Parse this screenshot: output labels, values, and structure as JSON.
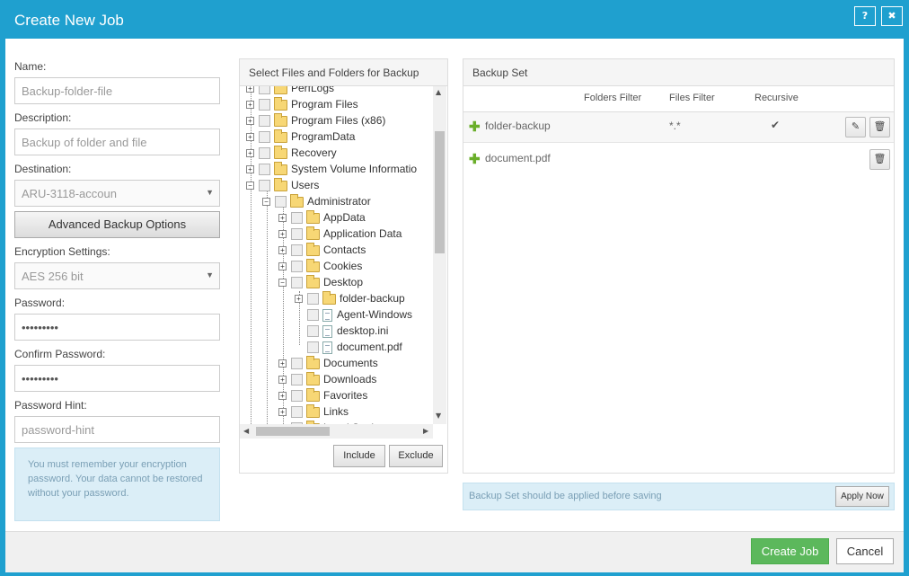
{
  "window": {
    "title": "Create New Job",
    "help_label": "?",
    "close_label": "✖"
  },
  "form": {
    "name_label": "Name:",
    "name_placeholder": "Backup-folder-file",
    "description_label": "Description:",
    "description_placeholder": "Backup of folder and file",
    "destination_label": "Destination:",
    "destination_value": "ARU-3118-accoun",
    "advanced_label": "Advanced Backup Options",
    "encryption_label": "Encryption Settings:",
    "encryption_value": "AES 256 bit",
    "password_label": "Password:",
    "password_value": "•••••••••",
    "confirm_label": "Confirm Password:",
    "confirm_value": "•••••••••",
    "hint_label": "Password Hint:",
    "hint_placeholder": "password-hint",
    "info_text": "You must remember your encryption password. Your data cannot be restored without your password."
  },
  "files_panel": {
    "title": "Select Files and Folders for Backup",
    "include_label": "Include",
    "exclude_label": "Exclude",
    "tree": [
      {
        "label": "PerfLogs",
        "kind": "folder",
        "depth": 0,
        "exp": "+"
      },
      {
        "label": "Program Files",
        "kind": "folder",
        "depth": 0,
        "exp": "+"
      },
      {
        "label": "Program Files (x86)",
        "kind": "folder",
        "depth": 0,
        "exp": "+"
      },
      {
        "label": "ProgramData",
        "kind": "folder",
        "depth": 0,
        "exp": "+"
      },
      {
        "label": "Recovery",
        "kind": "folder",
        "depth": 0,
        "exp": "+"
      },
      {
        "label": "System Volume Informatio",
        "kind": "folder",
        "depth": 0,
        "exp": "+"
      },
      {
        "label": "Users",
        "kind": "folder",
        "depth": 0,
        "exp": "-"
      },
      {
        "label": "Administrator",
        "kind": "folder",
        "depth": 1,
        "exp": "-"
      },
      {
        "label": "AppData",
        "kind": "folder",
        "depth": 2,
        "exp": "+"
      },
      {
        "label": "Application Data",
        "kind": "folder",
        "depth": 2,
        "exp": "+"
      },
      {
        "label": "Contacts",
        "kind": "folder",
        "depth": 2,
        "exp": "+"
      },
      {
        "label": "Cookies",
        "kind": "folder",
        "depth": 2,
        "exp": "+"
      },
      {
        "label": "Desktop",
        "kind": "folder",
        "depth": 2,
        "exp": "-"
      },
      {
        "label": "folder-backup",
        "kind": "folder",
        "depth": 3,
        "exp": "+"
      },
      {
        "label": "Agent-Windows",
        "kind": "file",
        "depth": 3,
        "exp": ""
      },
      {
        "label": "desktop.ini",
        "kind": "file",
        "depth": 3,
        "exp": ""
      },
      {
        "label": "document.pdf",
        "kind": "file",
        "depth": 3,
        "exp": ""
      },
      {
        "label": "Documents",
        "kind": "folder",
        "depth": 2,
        "exp": "+"
      },
      {
        "label": "Downloads",
        "kind": "folder",
        "depth": 2,
        "exp": "+"
      },
      {
        "label": "Favorites",
        "kind": "folder",
        "depth": 2,
        "exp": "+"
      },
      {
        "label": "Links",
        "kind": "folder",
        "depth": 2,
        "exp": "+"
      },
      {
        "label": "Local Settings",
        "kind": "folder",
        "depth": 2,
        "exp": "+"
      }
    ]
  },
  "backup_set": {
    "title": "Backup Set",
    "col_folders_filter": "Folders Filter",
    "col_files_filter": "Files Filter",
    "col_recursive": "Recursive",
    "rows": [
      {
        "name": "folder-backup",
        "files_filter": "*.*",
        "recursive": "✔"
      },
      {
        "name": "document.pdf",
        "files_filter": "",
        "recursive": ""
      }
    ],
    "apply_notice": "Backup Set should be applied before saving",
    "apply_label": "Apply Now"
  },
  "footer": {
    "create_label": "Create Job",
    "cancel_label": "Cancel"
  }
}
